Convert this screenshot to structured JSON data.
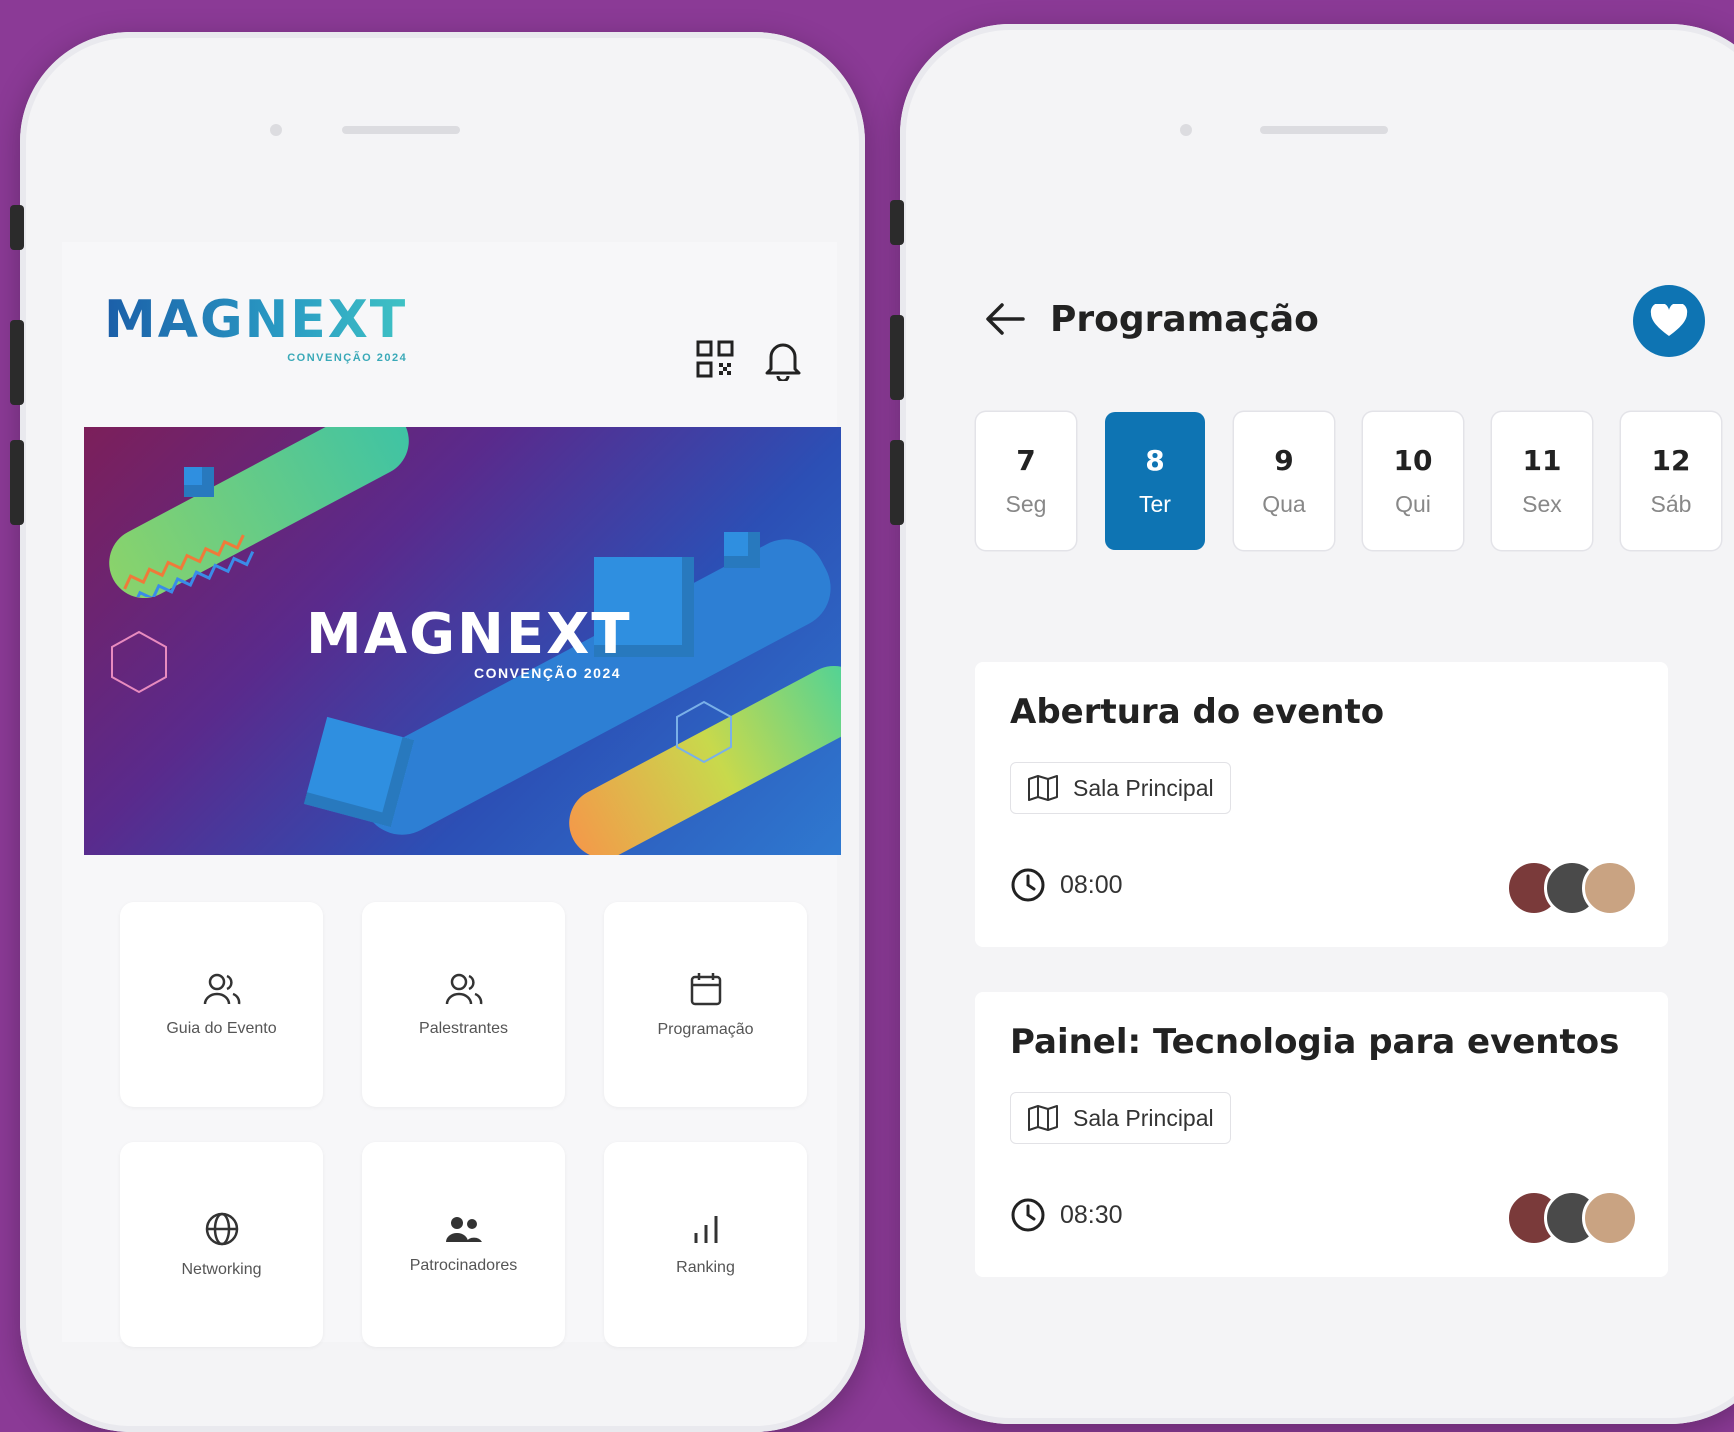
{
  "left_screen": {
    "logo": {
      "word": "MAGNEXT",
      "sub": "CONVENÇÃO 2024"
    },
    "icons": {
      "qr": "qr-code-icon",
      "bell": "bell-icon"
    },
    "banner": {
      "title": "MAGNEXT",
      "sub": "CONVENÇÃO 2024"
    },
    "menu": [
      {
        "label": "Guia do Evento",
        "icon": "users-icon"
      },
      {
        "label": "Palestrantes",
        "icon": "users-icon"
      },
      {
        "label": "Programação",
        "icon": "calendar-icon"
      },
      {
        "label": "Networking",
        "icon": "globe-icon"
      },
      {
        "label": "Patrocinadores",
        "icon": "people-icon"
      },
      {
        "label": "Ranking",
        "icon": "bar-chart-icon"
      }
    ]
  },
  "right_screen": {
    "title": "Programação",
    "days": [
      {
        "num": "7",
        "wd": "Seg",
        "selected": false
      },
      {
        "num": "8",
        "wd": "Ter",
        "selected": true
      },
      {
        "num": "9",
        "wd": "Qua",
        "selected": false
      },
      {
        "num": "10",
        "wd": "Qui",
        "selected": false
      },
      {
        "num": "11",
        "wd": "Sex",
        "selected": false
      },
      {
        "num": "12",
        "wd": "Sáb",
        "selected": false
      }
    ],
    "events": [
      {
        "title": "Abertura do evento",
        "room": "Sala Principal",
        "time": "08:00"
      },
      {
        "title": "Painel: Tecnologia para eventos",
        "room": "Sala Principal",
        "time": "08:30"
      }
    ]
  },
  "colors": {
    "background": "#8b3a96",
    "accent": "#0e74b3"
  }
}
